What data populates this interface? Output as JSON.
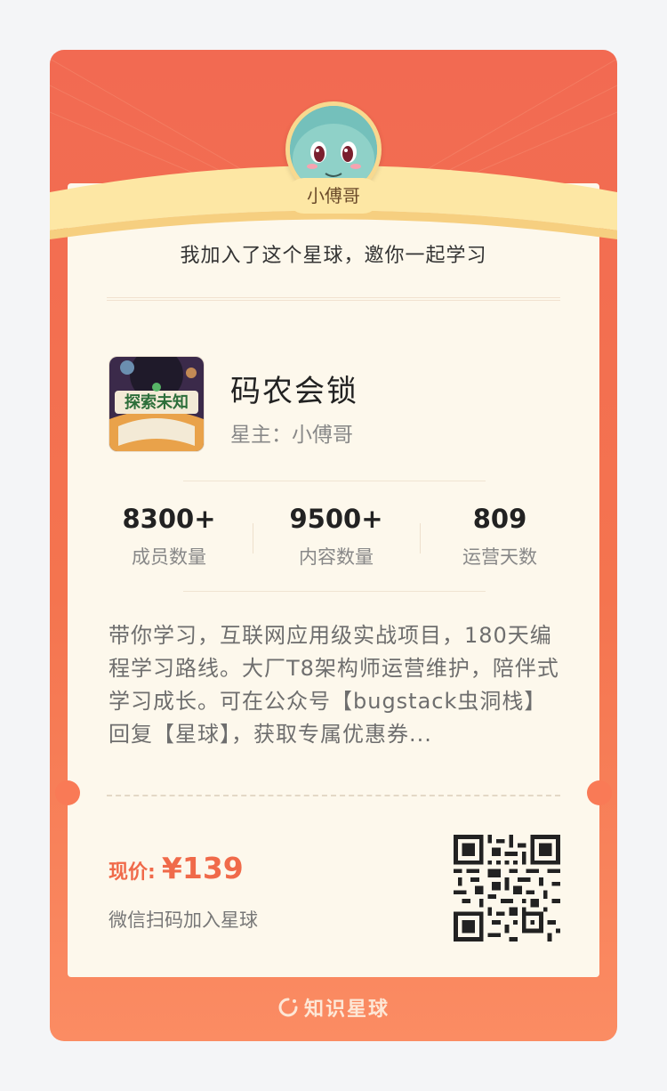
{
  "invite": {
    "owner_name": "小傅哥",
    "message": "我加入了这个星球，邀你一起学习"
  },
  "group": {
    "name": "码农会锁",
    "owner_line": "星主：小傅哥",
    "cover_text": "探索未知"
  },
  "stats": [
    {
      "value": "8300+",
      "label": "成员数量"
    },
    {
      "value": "9500+",
      "label": "内容数量"
    },
    {
      "value": "809",
      "label": "运营天数"
    }
  ],
  "description": "带你学习，互联网应用级实战项目，180天编程学习路线。大厂T8架构师运营维护，陪伴式学习成长。可在公众号【bugstack虫洞栈】回复【星球】，获取专属优惠券...",
  "price": {
    "label": "现价:",
    "value": "¥139"
  },
  "qr_hint": "微信扫码加入星球",
  "footer": {
    "brand": "知识星球"
  },
  "colors": {
    "card_red": "#f26a52",
    "price_orange": "#f06a4a",
    "banner_yellow": "#fde7a4"
  },
  "icons": {
    "brand": "planet-ring-icon"
  }
}
